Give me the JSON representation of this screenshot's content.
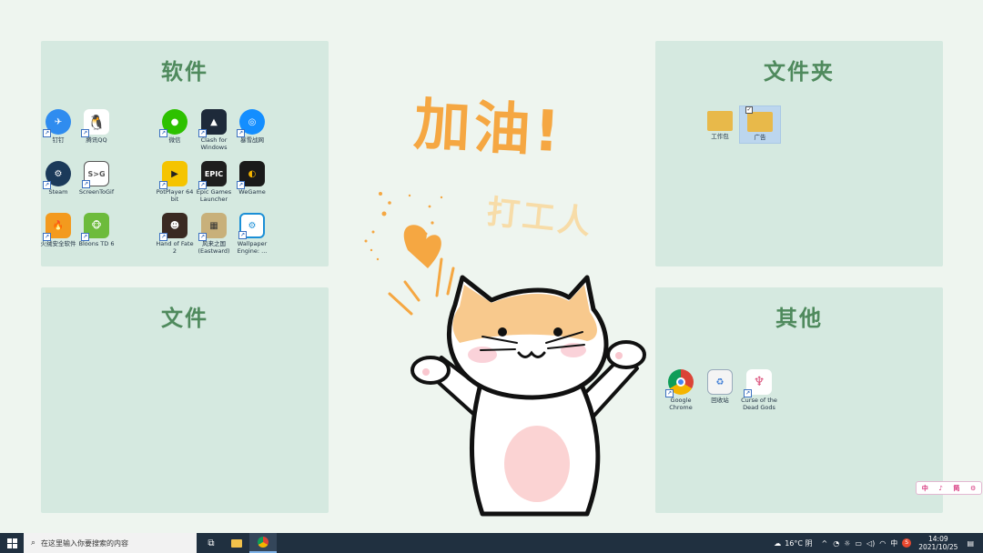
{
  "panels": {
    "software": {
      "title": "软件"
    },
    "folders": {
      "title": "文件夹"
    },
    "files": {
      "title": "文件"
    },
    "others": {
      "title": "其他"
    }
  },
  "software_icons": [
    {
      "label": "钉钉",
      "icon": "dingtalk-icon",
      "color": "#2f8cef"
    },
    {
      "label": "腾讯QQ",
      "icon": "qq-icon",
      "color": "#ffffff"
    },
    {
      "label": "微信",
      "icon": "wechat-icon",
      "color": "#2dc100"
    },
    {
      "label": "Clash for Windows",
      "icon": "clash-icon",
      "color": "#1e2a3a"
    },
    {
      "label": "暴雪战网",
      "icon": "battlenet-icon",
      "color": "#148eff"
    },
    {
      "label": "Steam",
      "icon": "steam-icon",
      "color": "#1b3a5a"
    },
    {
      "label": "ScreenToGif",
      "icon": "screentogif-icon",
      "color": "#ffffff"
    },
    {
      "label": "PotPlayer 64 bit",
      "icon": "potplayer-icon",
      "color": "#f5c400"
    },
    {
      "label": "Epic Games Launcher",
      "icon": "epic-icon",
      "color": "#1e1e1e"
    },
    {
      "label": "WeGame",
      "icon": "wegame-icon",
      "color": "#1a1a1a"
    },
    {
      "label": "火绒安全软件",
      "icon": "huorong-icon",
      "color": "#f39a1e"
    },
    {
      "label": "Bloons TD 6",
      "icon": "bloons-icon",
      "color": "#6dbb3c"
    },
    {
      "label": "Hand of Fate 2",
      "icon": "handoffate-icon",
      "color": "#3a2a22"
    },
    {
      "label": "风来之国 (Eastward)",
      "icon": "eastward-icon",
      "color": "#c8b07a"
    },
    {
      "label": "Wallpaper Engine: ...",
      "icon": "wallpaperengine-icon",
      "color": "#ffffff"
    }
  ],
  "folder_icons": [
    {
      "label": "工作包",
      "icon": "folder-icon",
      "color": "#e8b94a"
    },
    {
      "label": "广告",
      "icon": "folder-icon",
      "color": "#e8b94a",
      "selected": true
    }
  ],
  "other_icons": [
    {
      "label": "Google Chrome",
      "icon": "chrome-icon",
      "color": "#ffffff"
    },
    {
      "label": "回收站",
      "icon": "recycle-bin-icon",
      "color": "#ffffff"
    },
    {
      "label": "Curse of the Dead Gods",
      "icon": "cursegods-icon",
      "color": "#ffffff"
    }
  ],
  "decoration": {
    "headline": "加油!",
    "subline": "打工人",
    "headline_color": "#f5a742",
    "subline_color": "#f7dca8"
  },
  "ime_bar": {
    "labels": [
      "中",
      "♪",
      "简",
      "⚙"
    ]
  },
  "taskbar": {
    "search_placeholder": "在这里输入你要搜索的内容",
    "weather": "16°C 阴",
    "time": "14:09",
    "date": "2021/10/25",
    "ime": "中"
  }
}
